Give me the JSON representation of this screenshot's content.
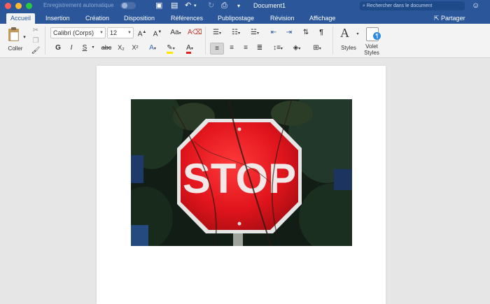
{
  "titlebar": {
    "autosave_label": "Enregistrement automatique",
    "doc_title": "Document1",
    "search_placeholder": "Rechercher dans le document"
  },
  "tabs": [
    {
      "label": "Accueil",
      "active": true
    },
    {
      "label": "Insertion"
    },
    {
      "label": "Création"
    },
    {
      "label": "Disposition"
    },
    {
      "label": "Références"
    },
    {
      "label": "Publipostage"
    },
    {
      "label": "Révision"
    },
    {
      "label": "Affichage"
    }
  ],
  "share_label": "Partager",
  "ribbon": {
    "paste_label": "Coller",
    "font_name": "Calibri (Corps)",
    "font_size": "12",
    "bold": "G",
    "italic": "I",
    "underline": "S",
    "strike": "abc",
    "subscript": "X₂",
    "superscript": "X²",
    "styles_label": "Styles",
    "styles_pane_label_1": "Volet",
    "styles_pane_label_2": "Styles"
  },
  "document": {
    "image_text": "STOP"
  },
  "colors": {
    "brand": "#2b579a",
    "highlight": "#ffe600",
    "font_color": "#e02020"
  }
}
